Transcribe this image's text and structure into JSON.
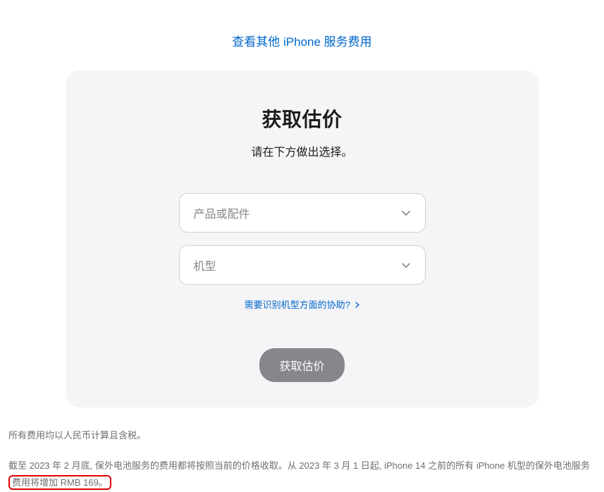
{
  "topLink": {
    "text": "查看其他 iPhone 服务费用"
  },
  "card": {
    "title": "获取估价",
    "subtitle": "请在下方做出选择。",
    "dropdown1": {
      "placeholder": "产品或配件"
    },
    "dropdown2": {
      "placeholder": "机型"
    },
    "helpLink": {
      "text": "需要识别机型方面的协助?"
    },
    "submitButton": {
      "label": "获取估价"
    }
  },
  "footer": {
    "line1": "所有费用均以人民币计算且含税。",
    "line2_part1": "截至 2023 年 2 月底, 保外电池服务的费用都将按照当前的价格收取。从 2023 年 3 月 1 日起, iPhone 14 之前的所有 iPhone 机型的保外电池服务",
    "line2_highlight": "费用将增加 RMB 169。"
  }
}
